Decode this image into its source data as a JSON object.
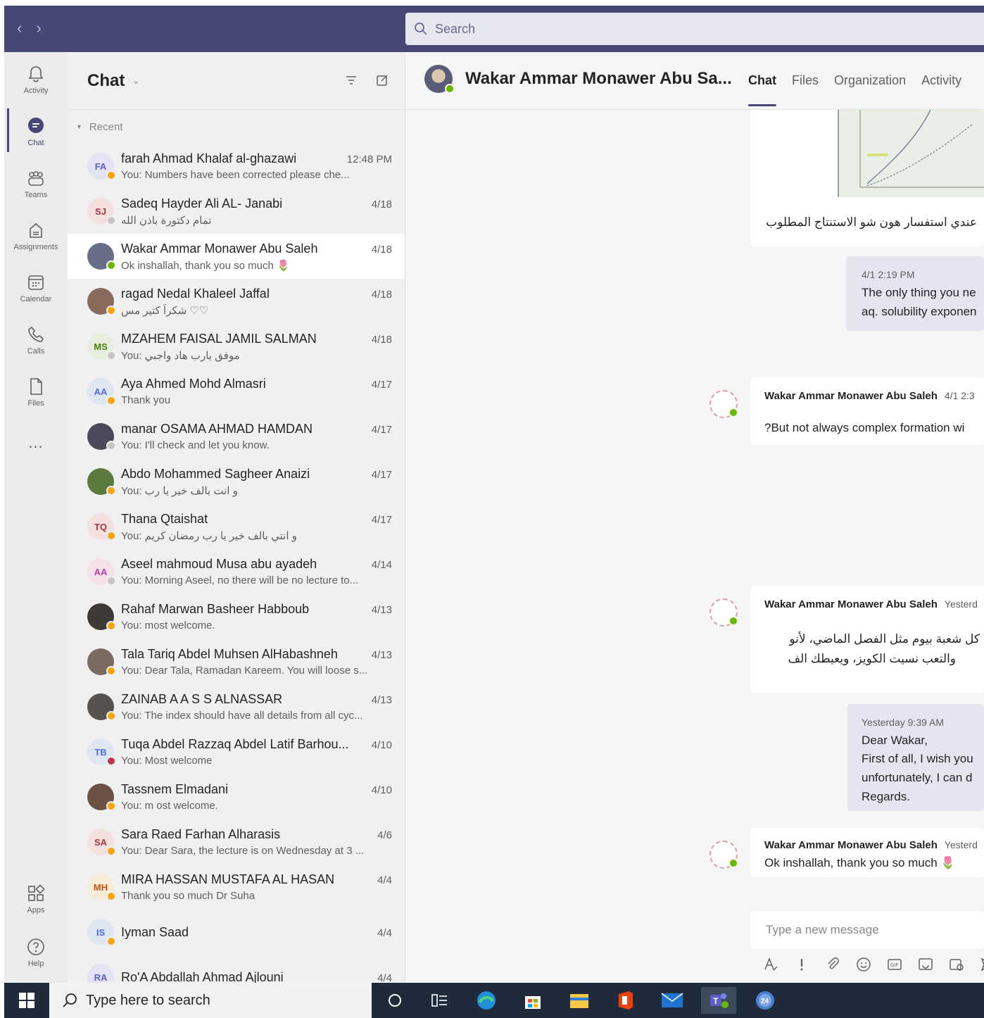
{
  "topbar": {
    "back": "‹",
    "forward": "›",
    "search_placeholder": "Search"
  },
  "rail": [
    {
      "label": "Activity",
      "icon": "bell-icon"
    },
    {
      "label": "Chat",
      "icon": "chat-icon",
      "active": true
    },
    {
      "label": "Teams",
      "icon": "teams-icon"
    },
    {
      "label": "Assignments",
      "icon": "assignments-icon"
    },
    {
      "label": "Calendar",
      "icon": "calendar-icon"
    },
    {
      "label": "Calls",
      "icon": "phone-icon"
    },
    {
      "label": "Files",
      "icon": "file-icon"
    },
    {
      "label": "...",
      "icon": "more-icon"
    },
    {
      "label": "Apps",
      "icon": "apps-icon"
    },
    {
      "label": "Help",
      "icon": "help-icon"
    }
  ],
  "list": {
    "title": "Chat",
    "section": "Recent",
    "chats": [
      {
        "name": "farah Ahmad Khalaf al-ghazawi",
        "time": "12:48 PM",
        "preview": "You: Numbers have been corrected please che...",
        "initials": "FA",
        "bg": "#e3e3f4",
        "fg": "#5b5fc7",
        "status": "#f8a60e"
      },
      {
        "name": "Sadeq Hayder Ali AL- Janabi",
        "time": "4/18",
        "preview": "تمام دكتورة باذن الله",
        "initials": "SJ",
        "bg": "#f4e1df",
        "fg": "#a4373a",
        "status": "#c8c6c4"
      },
      {
        "name": "Wakar Ammar Monawer Abu Saleh",
        "time": "4/18",
        "preview": "Ok inshallah, thank you so much 🌷",
        "initials": "",
        "bg": "#6a6d88",
        "fg": "#ffffff",
        "status": "#6bb700",
        "selected": true
      },
      {
        "name": "ragad Nedal Khaleel Jaffal",
        "time": "4/18",
        "preview": "شكراً كتير مس ♡♡",
        "initials": "",
        "bg": "#8b6a5e",
        "fg": "#ffffff",
        "status": "#f8a60e"
      },
      {
        "name": "MZAHEM FAISAL JAMIL SALMAN",
        "time": "4/18",
        "preview": "You: موفق يارب هاد واجبي",
        "initials": "MS",
        "bg": "#e6eee0",
        "fg": "#498205",
        "status": "#c8c6c4"
      },
      {
        "name": "Aya Ahmed Mohd Almasri",
        "time": "4/17",
        "preview": "Thank you",
        "initials": "AA",
        "bg": "#dde6f1",
        "fg": "#4f6bed",
        "status": "#f8a60e"
      },
      {
        "name": "manar OSAMA AHMAD HAMDAN",
        "time": "4/17",
        "preview": "You: I'll check and let you know.",
        "initials": "",
        "bg": "#4a4a5a",
        "fg": "#ffffff",
        "status": "#c8c6c4"
      },
      {
        "name": "Abdo Mohammed Sagheer Anaizi",
        "time": "4/17",
        "preview": "You: و انت بالف خير يا رب",
        "initials": "",
        "bg": "#5d7a3e",
        "fg": "#ffffff",
        "status": "#f8a60e"
      },
      {
        "name": "Thana Qtaishat",
        "time": "4/17",
        "preview": "You: و انتي بالف خير يا رب رمضان كريم",
        "initials": "TQ",
        "bg": "#f4e1df",
        "fg": "#a4373a",
        "status": "#f8a60e"
      },
      {
        "name": "Aseel mahmoud Musa abu ayadeh",
        "time": "4/14",
        "preview": "You: Morning Aseel, no there will be no lecture to...",
        "initials": "AA",
        "bg": "#f4e1e8",
        "fg": "#c239b3",
        "status": "#c8c6c4"
      },
      {
        "name": "Rahaf Marwan Basheer Habboub",
        "time": "4/13",
        "preview": "You: most welcome.",
        "initials": "",
        "bg": "#3f3a36",
        "fg": "#ffffff",
        "status": "#f8a60e"
      },
      {
        "name": "Tala Tariq Abdel Muhsen AlHabashneh",
        "time": "4/13",
        "preview": "You: Dear Tala, Ramadan Kareem. You will loose s...",
        "initials": "",
        "bg": "#7a6a60",
        "fg": "#ffffff",
        "status": "#f8a60e"
      },
      {
        "name": "ZAINAB A A S S ALNASSAR",
        "time": "4/13",
        "preview": "You: The index should have all details from all cyc...",
        "initials": "",
        "bg": "#55524f",
        "fg": "#ffffff",
        "status": "#f8a60e"
      },
      {
        "name": "Tuqa Abdel Razzaq Abdel Latif Barhou...",
        "time": "4/10",
        "preview": "You: Most welcome",
        "initials": "TB",
        "bg": "#dde6f1",
        "fg": "#4f6bed",
        "status": "#c4314b"
      },
      {
        "name": "Tassnem Elmadani",
        "time": "4/10",
        "preview": "You: m ost welcome.",
        "initials": "",
        "bg": "#6b5244",
        "fg": "#ffffff",
        "status": "#f8a60e"
      },
      {
        "name": "Sara Raed Farhan Alharasis",
        "time": "4/6",
        "preview": "You: Dear Sara, the lecture is on Wednesday at 3 ...",
        "initials": "SA",
        "bg": "#f4e1df",
        "fg": "#a4373a",
        "status": "#f8a60e"
      },
      {
        "name": "MIRA HASSAN MUSTAFA AL HASAN",
        "time": "4/4",
        "preview": "Thank you so much Dr Suha",
        "initials": "MH",
        "bg": "#f7ecd8",
        "fg": "#ca5010",
        "status": "#f8a60e"
      },
      {
        "name": "Iyman Saad",
        "time": "4/4",
        "preview": "",
        "initials": "IS",
        "bg": "#dde6f1",
        "fg": "#4f6bed",
        "status": "#f8a60e"
      },
      {
        "name": "Ro'A Abdallah Ahmad Ajlouni",
        "time": "4/4",
        "preview": "",
        "initials": "RA",
        "bg": "#e3e3f4",
        "fg": "#5b5fc7",
        "status": "#f8a60e"
      }
    ]
  },
  "convo": {
    "title": "Wakar Ammar Monawer Abu Sa...",
    "tabs": [
      "Chat",
      "Files",
      "Organization",
      "Activity"
    ],
    "messages": {
      "m1_text": "عندي استفسار هون شو الاستنتاج المطلوب",
      "m2_time": "4/1 2:19 PM",
      "m2_line1": "The only thing you ne",
      "m2_line2": "aq. solubility exponen",
      "m3_sender": "Wakar Ammar Monawer Abu Saleh",
      "m3_time": "4/1 2:3",
      "m3_text": "?But not always complex formation wi",
      "m4_sender": "Wakar Ammar Monawer Abu Saleh",
      "m4_time": "Yesterd",
      "m4_line1": "كل شعبة بيوم مثل الفصل الماضي، لأنو",
      "m4_line2": "والتعب نسيت الكويز، ويعيطك الف",
      "m5_time": "Yesterday 9:39 AM",
      "m5_line1": "Dear Wakar,",
      "m5_line2": "First of all, I wish you",
      "m5_line3": "unfortunately, I can d",
      "m5_line4": "Regards.",
      "m6_sender": "Wakar Ammar Monawer Abu Saleh",
      "m6_time": "Yesterd",
      "m6_text": "Ok inshallah, thank you so much 🌷"
    },
    "compose_placeholder": "Type a new message"
  },
  "taskbar": {
    "search_placeholder": "Type here to search"
  },
  "colors": {
    "brand": "#464775",
    "online": "#6bb700",
    "away": "#f8a60e",
    "busy": "#c4314b"
  }
}
